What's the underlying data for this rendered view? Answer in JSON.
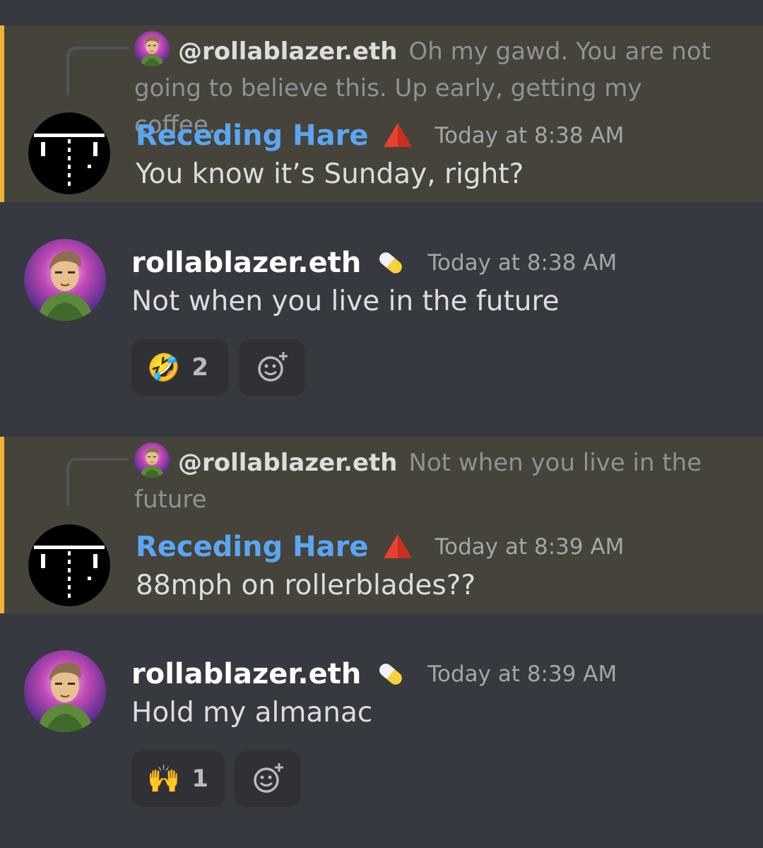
{
  "colors": {
    "background": "#36393f",
    "highlight_background": "#46433b",
    "highlight_bar": "#f0b232",
    "username_blue": "#5aa6f2",
    "reaction_background": "#2f3136"
  },
  "messages": [
    {
      "reply": {
        "author": "@rollablazer.eth",
        "text": "Oh my gawd. You are not going to believe this.  Up early, getting my coffee.…"
      },
      "author": "Receding Hare",
      "role_icon": "red-triangle-icon",
      "timestamp": "Today at 8:38 AM",
      "body": "You know it’s Sunday, right?"
    },
    {
      "author": "rollablazer.eth",
      "role_icon": "pill-icon",
      "timestamp": "Today at 8:38 AM",
      "body": "Not when you live in the future",
      "reactions": [
        {
          "emoji": "🤣",
          "icon": "rolling-on-floor-laughing-emoji",
          "count": "2"
        }
      ],
      "add_reaction_icon": "add-reaction-icon"
    },
    {
      "reply": {
        "author": "@rollablazer.eth",
        "text": "Not when you live in the future"
      },
      "author": "Receding Hare",
      "role_icon": "red-triangle-icon",
      "timestamp": "Today at 8:39 AM",
      "body": "88mph on rollerblades??"
    },
    {
      "author": "rollablazer.eth",
      "role_icon": "pill-icon",
      "timestamp": "Today at 8:39 AM",
      "body": "Hold my almanac",
      "reactions": [
        {
          "emoji": "🙌",
          "icon": "raising-hands-emoji",
          "count": "1"
        }
      ],
      "add_reaction_icon": "add-reaction-icon"
    }
  ]
}
